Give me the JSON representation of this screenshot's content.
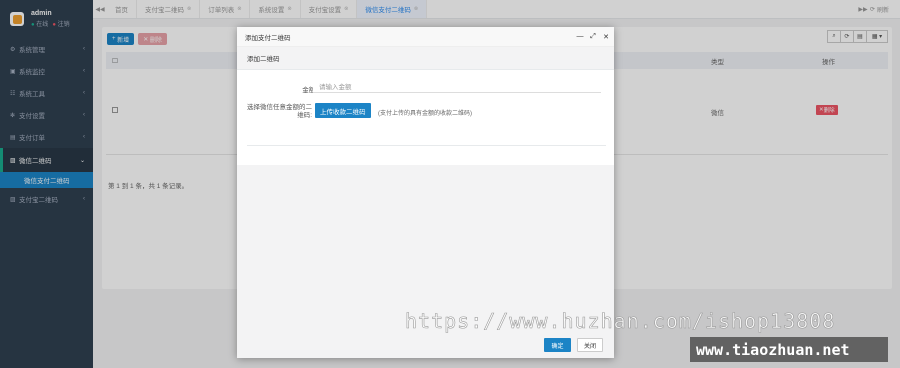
{
  "sidebar": {
    "user": {
      "name": "admin",
      "online": "在线",
      "logout": "注销"
    },
    "items": [
      {
        "label": "系统管理",
        "icon": "gear-icon"
      },
      {
        "label": "系统监控",
        "icon": "monitor-icon"
      },
      {
        "label": "系统工具",
        "icon": "tools-icon"
      },
      {
        "label": "支付设置",
        "icon": "cog-icon"
      },
      {
        "label": "支付订单",
        "icon": "order-icon"
      },
      {
        "label": "微信二维码",
        "icon": "image-icon"
      },
      {
        "label": "支付宝二维码",
        "icon": "image-icon"
      }
    ],
    "subitem": "微信支付二维码"
  },
  "topbar": {
    "tabs": [
      "首页",
      "支付宝二维码",
      "订单列表",
      "系统设置",
      "支付宝设置",
      "微信支付二维码"
    ],
    "refresh": "刷新"
  },
  "content": {
    "add_label": "新增",
    "delete_label": "删除",
    "columns": {
      "type": "类型",
      "operation": "操作"
    },
    "row": {
      "type": "微信",
      "delete": "删除"
    },
    "pager": "第 1 到 1 条，共 1 条记录。"
  },
  "modal": {
    "title": "添加支付二维码",
    "panel_title": "添加二维码",
    "amount_label": "金额:",
    "amount_placeholder": "请输入金额",
    "qr_label": "选择微信任意金额的二维码:",
    "upload_label": "上传收款二维码",
    "upload_hint": "(支付上传的具有金额的收款二维码)",
    "ok": "确定",
    "close": "关闭"
  },
  "watermarks": {
    "url1": "https://www.huzhan.com/ishop13808",
    "url2": "www.tiaozhuan.net"
  }
}
